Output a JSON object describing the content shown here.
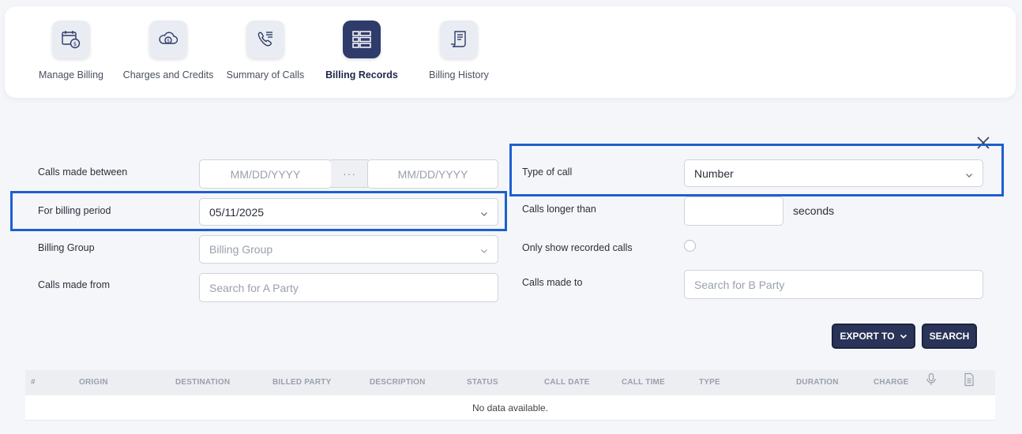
{
  "nav": {
    "items": [
      {
        "label": "Manage Billing",
        "icon": "calendar-dollar-icon"
      },
      {
        "label": "Charges and Credits",
        "icon": "cloud-dollar-icon"
      },
      {
        "label": "Summary of Calls",
        "icon": "phone-list-icon"
      },
      {
        "label": "Billing Records",
        "icon": "records-list-icon",
        "active": true
      },
      {
        "label": "Billing History",
        "icon": "scroll-history-icon"
      }
    ],
    "active_color": "#2f3b6b"
  },
  "form": {
    "calls_made_between": {
      "label": "Calls made between",
      "from_placeholder": "MM/DD/YYYY",
      "separator": "···",
      "to_placeholder": "MM/DD/YYYY"
    },
    "billing_period": {
      "label": "For billing period",
      "value": "05/11/2025"
    },
    "billing_group": {
      "label": "Billing Group",
      "placeholder": "Billing Group"
    },
    "calls_made_from": {
      "label": "Calls made from",
      "placeholder": "Search for A Party"
    },
    "type_of_call": {
      "label": "Type of call",
      "value": "Number"
    },
    "calls_longer_than": {
      "label": "Calls longer than",
      "value": "",
      "unit": "seconds"
    },
    "recorded_only": {
      "label": "Only show recorded calls",
      "checked": false
    },
    "calls_made_to": {
      "label": "Calls made to",
      "placeholder": "Search for B Party"
    }
  },
  "actions": {
    "export_label": "EXPORT TO",
    "search_label": "SEARCH"
  },
  "table": {
    "columns": [
      "#",
      "ORIGIN",
      "DESTINATION",
      "BILLED PARTY",
      "DESCRIPTION",
      "STATUS",
      "CALL DATE",
      "CALL TIME",
      "TYPE",
      "DURATION",
      "CHARGE"
    ],
    "icon_columns": [
      "microphone-icon",
      "document-icon"
    ],
    "empty_text": "No data available."
  },
  "colors": {
    "primary": "#2a3358",
    "highlight": "#1e5fd0"
  }
}
